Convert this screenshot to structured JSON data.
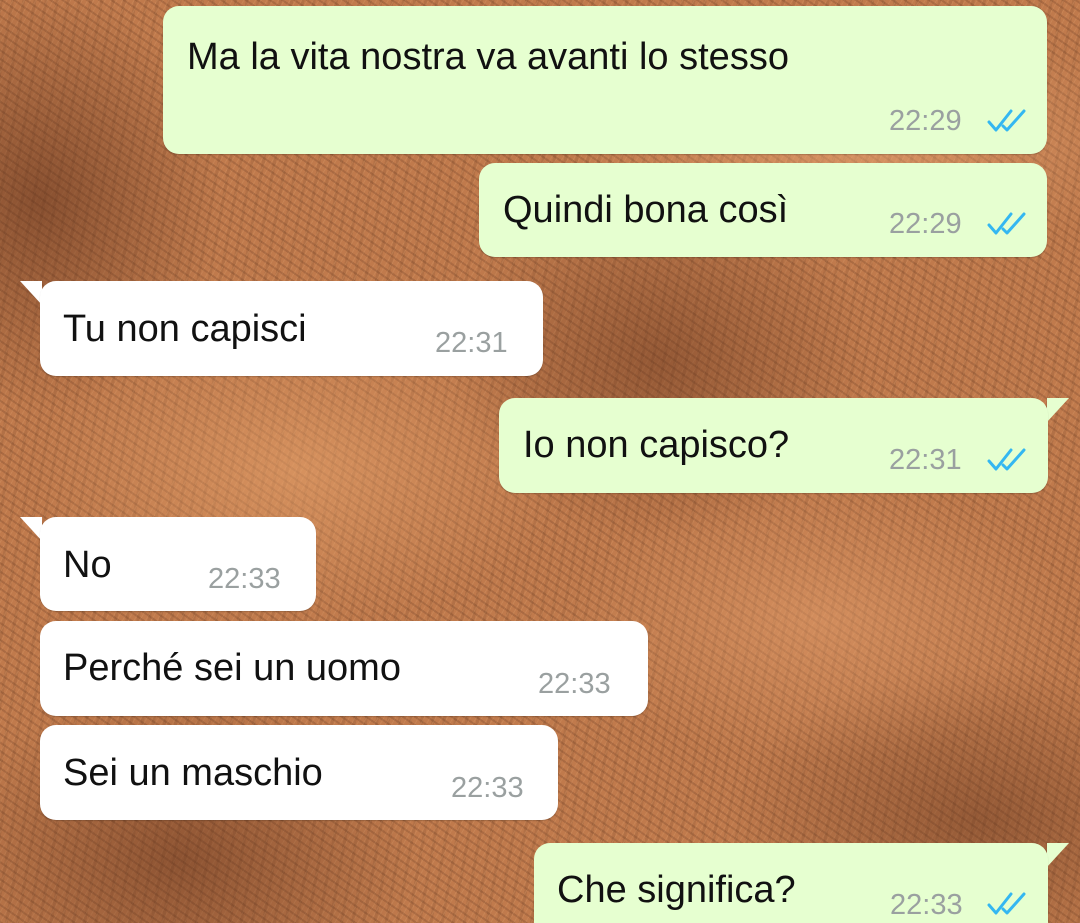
{
  "colors": {
    "outgoing_bubble": "#e6ffd0",
    "incoming_bubble": "#ffffff",
    "read_tick": "#34b7f1",
    "timestamp": "#9aa0a0"
  },
  "messages": [
    {
      "direction": "outgoing",
      "text": "Ma la vita nostra va avanti lo stesso",
      "time": "22:29",
      "status_icon": "double-check-read-icon"
    },
    {
      "direction": "outgoing",
      "text": "Quindi bona così",
      "time": "22:29",
      "status_icon": "double-check-read-icon"
    },
    {
      "direction": "incoming",
      "text": "Tu non capisci",
      "time": "22:31"
    },
    {
      "direction": "outgoing",
      "text": "Io non capisco?",
      "time": "22:31",
      "status_icon": "double-check-read-icon"
    },
    {
      "direction": "incoming",
      "text": "No",
      "time": "22:33"
    },
    {
      "direction": "incoming",
      "text": "Perché sei un uomo",
      "time": "22:33"
    },
    {
      "direction": "incoming",
      "text": "Sei un maschio",
      "time": "22:33"
    },
    {
      "direction": "outgoing",
      "text": "Che significa?",
      "time": "22:33",
      "status_icon": "double-check-read-icon"
    }
  ]
}
